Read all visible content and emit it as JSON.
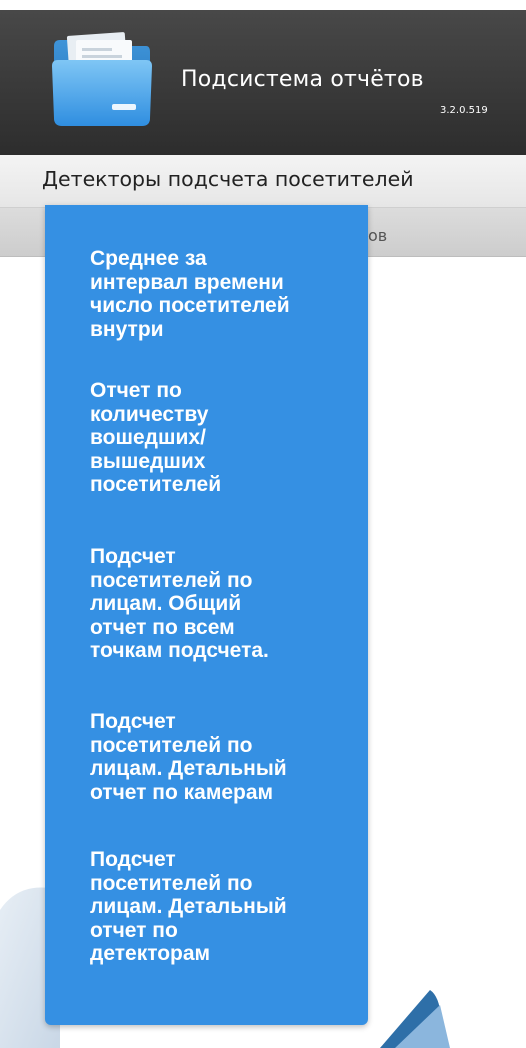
{
  "header": {
    "title": "Подсистема отчётов",
    "version": "3.2.0.519",
    "icon": "folder-icon",
    "colors": {
      "background": "#3a3a3a",
      "text": "#ffffff"
    }
  },
  "menubar": {
    "active_item": "Детекторы подсчета посетителей"
  },
  "subbar": {
    "label": "тчётов"
  },
  "dropdown": {
    "background": "#3590e3",
    "items": [
      {
        "label": "Среднее за\nинтервал времени\nчисло посетителей\nвнутри"
      },
      {
        "label": "Отчет по\nколичеству\nвошедших/\nвышедших\nпосетителей"
      },
      {
        "label": "Подсчет\nпосетителей по\nлицам. Общий\nотчет по всем\nточкам подсчета."
      },
      {
        "label": "Подсчет\nпосетителей по\nлицам. Детальный\nотчет по камерам"
      },
      {
        "label": "Подсчет\nпосетителей по\nлицам. Детальный\nотчет по\nдетекторам"
      }
    ]
  }
}
